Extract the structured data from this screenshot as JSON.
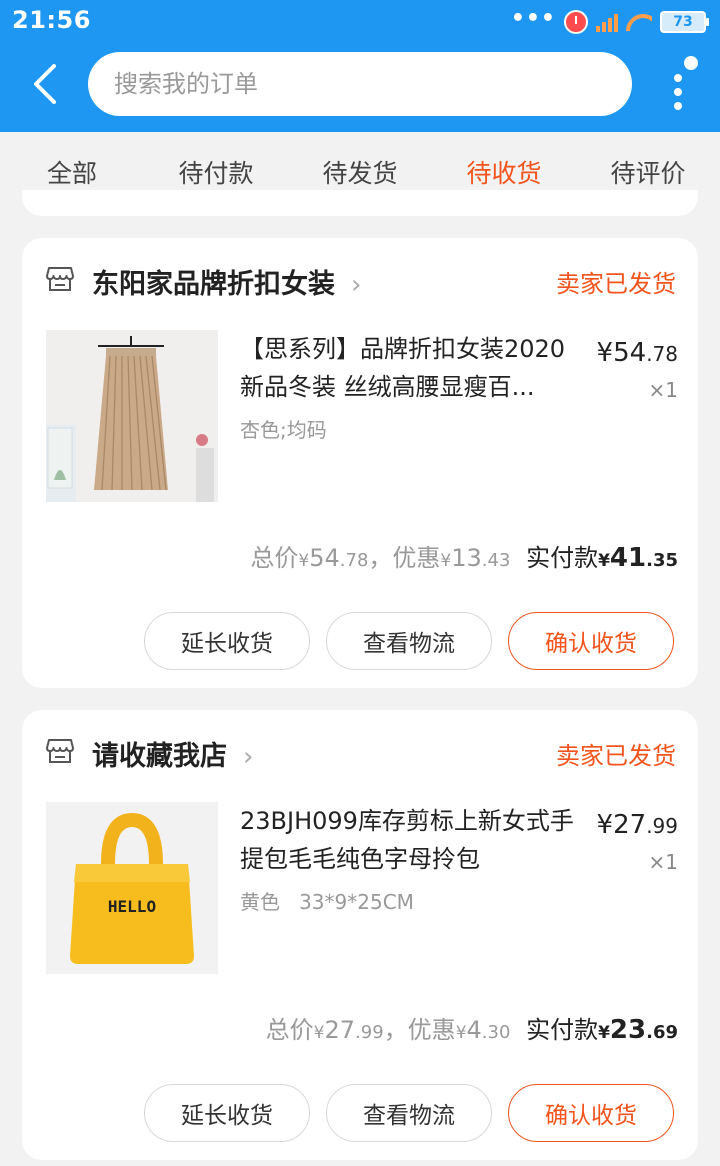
{
  "status_bar": {
    "time": "21:56",
    "battery": "73"
  },
  "header": {
    "search_placeholder": "搜索我的订单"
  },
  "tabs": [
    {
      "label": "全部",
      "active": false
    },
    {
      "label": "待付款",
      "active": false
    },
    {
      "label": "待发货",
      "active": false
    },
    {
      "label": "待收货",
      "active": true
    },
    {
      "label": "待评价",
      "active": false
    }
  ],
  "orders": [
    {
      "shop_name": "东阳家品牌折扣女装",
      "status": "卖家已发货",
      "product_title": "【思系列】品牌折扣女装2020新品冬装 丝绒高腰显瘦百...",
      "sku": "杏色;均码",
      "price_int": "¥54",
      "price_dec": ".78",
      "qty": "×1",
      "total_label": "总价",
      "total_int": "54",
      "total_dec": ".78",
      "discount_label": "，优惠",
      "discount_int": "13",
      "discount_dec": ".43",
      "paid_label": "实付款",
      "paid_int": "41",
      "paid_dec": ".35",
      "buttons": {
        "extend": "延长收货",
        "logistics": "查看物流",
        "confirm": "确认收货"
      }
    },
    {
      "shop_name": "请收藏我店",
      "status": "卖家已发货",
      "product_title": "23BJH099库存剪标上新女式手提包毛毛纯色字母拎包",
      "sku": "黄色   33*9*25CM",
      "price_int": "¥27",
      "price_dec": ".99",
      "qty": "×1",
      "bag_text": "HELLO",
      "total_label": "总价",
      "total_int": "27",
      "total_dec": ".99",
      "discount_label": "，优惠",
      "discount_int": "4",
      "discount_dec": ".30",
      "paid_label": "实付款",
      "paid_int": "23",
      "paid_dec": ".69",
      "buttons": {
        "extend": "延长收货",
        "logistics": "查看物流",
        "confirm": "确认收货"
      }
    }
  ],
  "colors": {
    "header_blue": "#1e97f3",
    "accent_orange": "#f2541c",
    "page_bg": "#f2f2f2"
  }
}
